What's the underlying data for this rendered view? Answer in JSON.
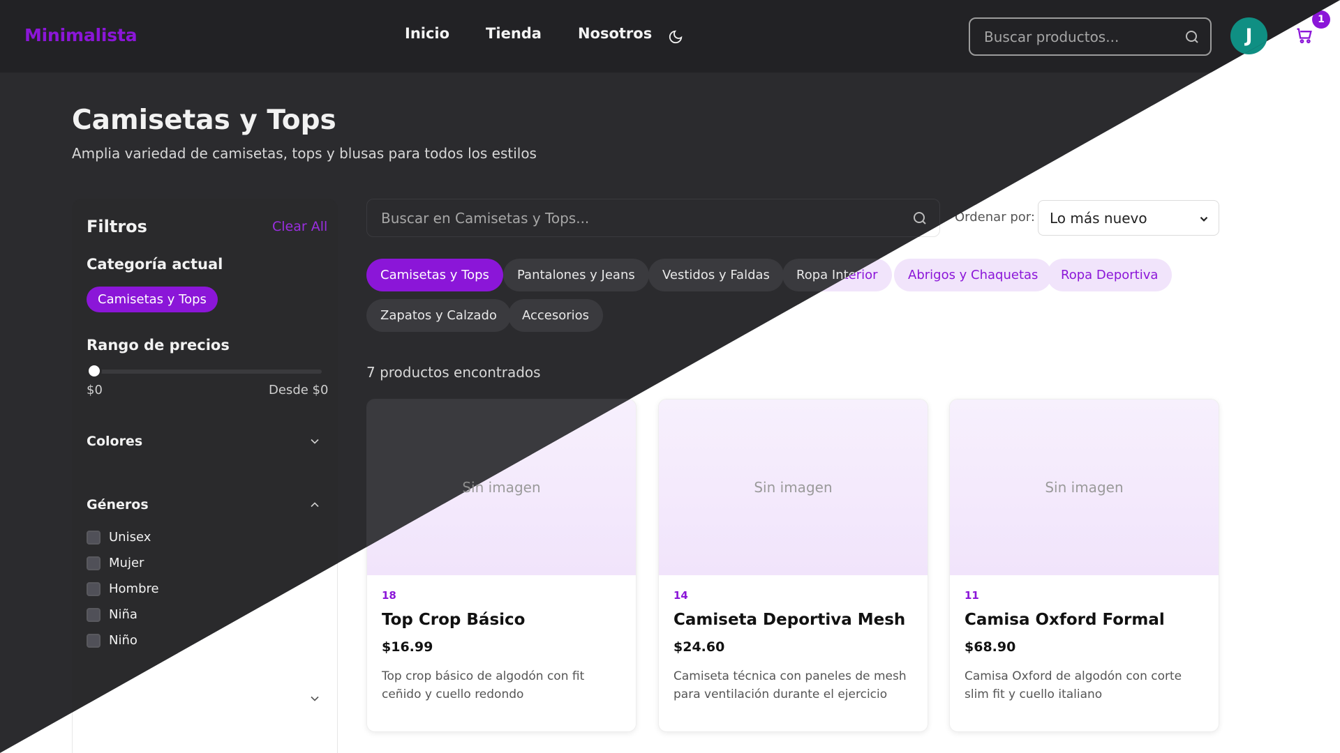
{
  "header": {
    "logo": "Minimalista",
    "nav": [
      "Inicio",
      "Tienda",
      "Nosotros"
    ],
    "search_placeholder": "Buscar productos...",
    "avatar_initial": "J",
    "cart_count": "1",
    "icons": [
      "moon-icon",
      "search-icon",
      "cart-icon"
    ]
  },
  "page": {
    "title": "Camisetas y Tops",
    "subtitle": "Amplia variedad de camisetas, tops y blusas para todos los estilos"
  },
  "sidebar": {
    "title": "Filtros",
    "clear_all": "Clear All",
    "current_category_label": "Categoría actual",
    "current_category": "Camisetas y Tops",
    "price_range_label": "Rango de precios",
    "price_min": "$0",
    "price_from": "Desde $0",
    "colors_label": "Colores",
    "genders_label": "Géneros",
    "genders": [
      "Unisex",
      "Mujer",
      "Hombre",
      "Niña",
      "Niño"
    ]
  },
  "main": {
    "search_placeholder": "Buscar en Camisetas y Tops...",
    "sort_label": "Ordenar por:",
    "sort_value": "Lo más nuevo",
    "categories": [
      {
        "label": "Camisetas y Tops",
        "active": true
      },
      {
        "label": "Pantalones y Jeans"
      },
      {
        "label": "Vestidos y Faldas"
      },
      {
        "label": "Ropa Interior"
      },
      {
        "label": "Abrigos y Chaquetas"
      },
      {
        "label": "Ropa Deportiva"
      },
      {
        "label": "Zapatos y Calzado"
      },
      {
        "label": "Accesorios"
      }
    ],
    "found_text": "7 productos encontrados",
    "products": [
      {
        "image_placeholder": "Sin imagen",
        "number": "18",
        "name": "Top Crop Básico",
        "price": "$16.99",
        "description": "Top crop básico de algodón con fit ceñido y cuello redondo"
      },
      {
        "image_placeholder": "Sin imagen",
        "number": "14",
        "name": "Camiseta Deportiva Mesh",
        "price": "$24.60",
        "description": "Camiseta técnica con paneles de mesh para ventilación durante el ejercicio"
      },
      {
        "image_placeholder": "Sin imagen",
        "number": "11",
        "name": "Camisa Oxford Formal",
        "price": "$68.90",
        "description": "Camisa Oxford de algodón con corte slim fit y cuello italiano"
      }
    ]
  },
  "colors": {
    "accent": "#8b16d8",
    "avatar_bg": "#0f8f83",
    "dark_bg": "#2b2b2e",
    "light_bg": "#ffffff"
  }
}
